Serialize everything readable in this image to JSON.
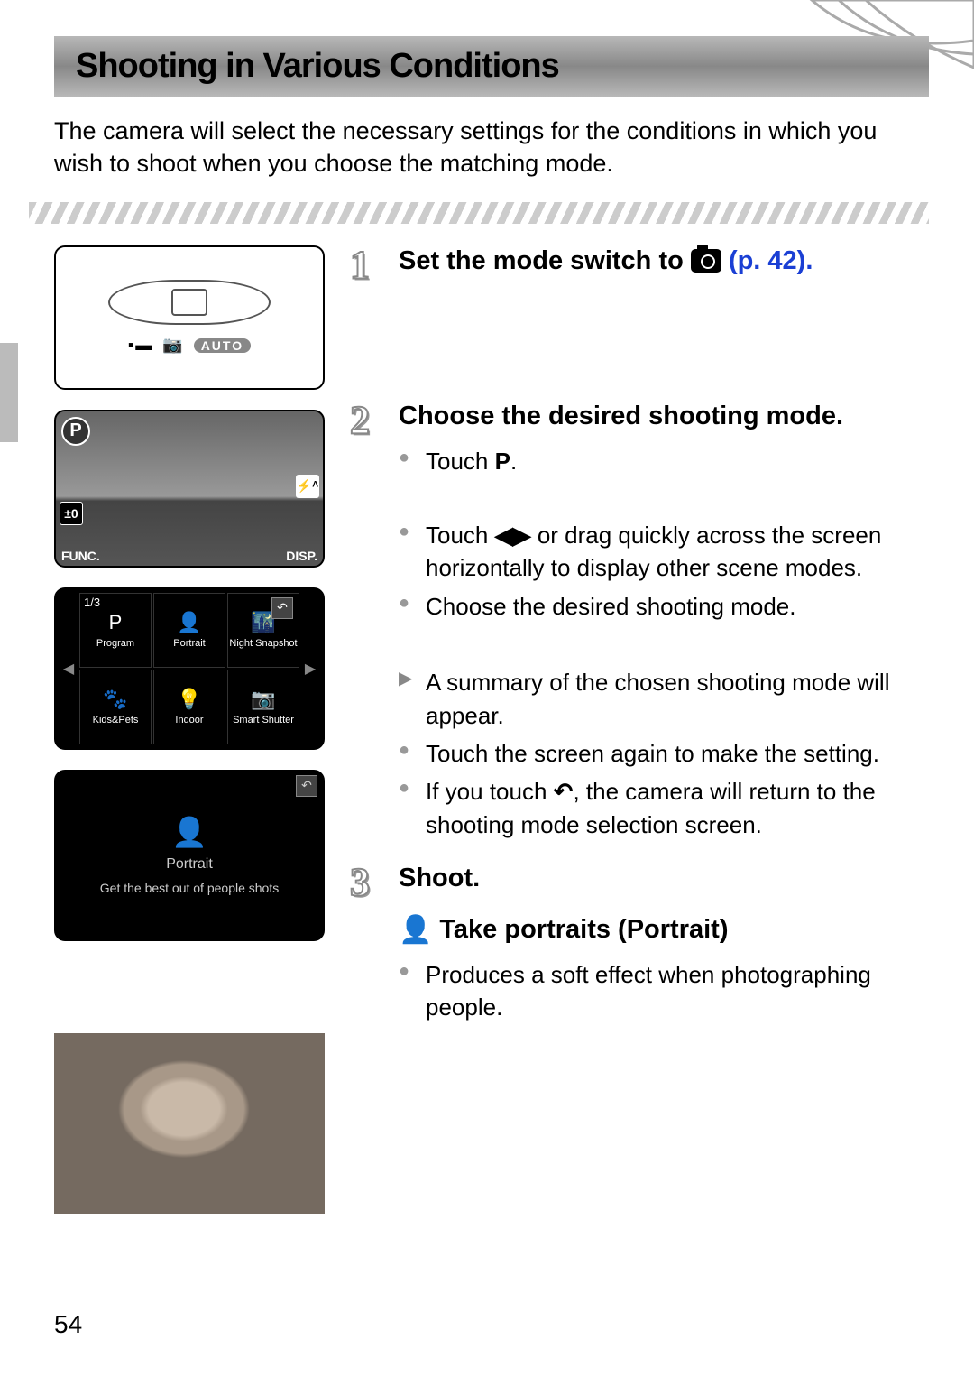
{
  "page_number": "54",
  "heading": "Shooting in Various Conditions",
  "intro": "The camera will select the necessary settings for the conditions in which you wish to shoot when you choose the matching mode.",
  "steps": {
    "s1": {
      "num": "1",
      "title_pre": "Set the mode switch to ",
      "page_ref": "(p. 42)."
    },
    "s2": {
      "num": "2",
      "title": "Choose the desired shooting mode.",
      "b1a": "Touch ",
      "b1b": ".",
      "b2a": "Touch ",
      "b2b": " or drag quickly across the screen horizontally to display other scene modes.",
      "b3": "Choose the desired shooting mode.",
      "b4": "A summary of the chosen shooting mode will appear.",
      "b5": "Touch the screen again to make the setting.",
      "b6a": "If you touch ",
      "b6b": ", the camera will return to the shooting mode selection screen."
    },
    "s3": {
      "num": "3",
      "title": "Shoot."
    }
  },
  "portrait_section": {
    "heading": "Take portraits (Portrait)",
    "bullet": "Produces a soft effect when photographing people."
  },
  "dial": {
    "movie": "▪▬",
    "cam": "📷",
    "auto": "AUTO"
  },
  "city_screen": {
    "p": "P",
    "ev": "±0",
    "func": "FUNC.",
    "disp": "DISP.",
    "flash": "⚡ᴬ"
  },
  "grid": {
    "page": "1/3",
    "cells": [
      {
        "ico": "P",
        "lbl": "Program"
      },
      {
        "ico": "👤",
        "lbl": "Portrait"
      },
      {
        "ico": "🌃",
        "lbl": "Night Snapshot"
      },
      {
        "ico": "🐾",
        "lbl": "Kids&Pets"
      },
      {
        "ico": "💡",
        "lbl": "Indoor"
      },
      {
        "ico": "📷",
        "lbl": "Smart Shutter"
      }
    ]
  },
  "portrait_screen": {
    "title": "Portrait",
    "desc": "Get the best out of people shots"
  }
}
